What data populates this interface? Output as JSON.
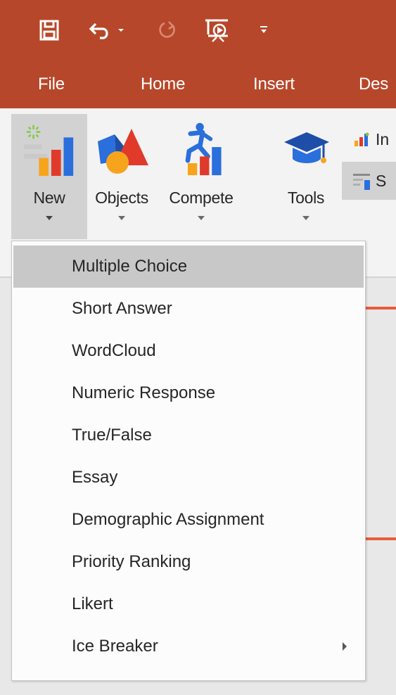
{
  "ribbon_tabs": [
    "File",
    "Home",
    "Insert",
    "Des"
  ],
  "ribbon_buttons": {
    "new_label": "New",
    "objects_label": "Objects",
    "compete_label": "Compete",
    "tools_label": "Tools"
  },
  "small_buttons": {
    "top_label": "In",
    "bottom_label": "S"
  },
  "new_menu": {
    "items": [
      "Multiple Choice",
      "Short Answer",
      "WordCloud",
      "Numeric Response",
      "True/False",
      "Essay",
      "Demographic Assignment",
      "Priority Ranking",
      "Likert",
      "Ice Breaker"
    ],
    "selected": "Multiple Choice"
  },
  "icons": {
    "save": "save-icon",
    "undo": "undo-icon",
    "redo": "redo-icon",
    "slideshow": "start-from-beginning-icon",
    "customize": "customize-qat-icon",
    "new": "new-question-icon",
    "objects": "objects-icon",
    "compete": "compete-icon",
    "tools": "tools-icon"
  },
  "colors": {
    "titlebar": "#b7472a",
    "accent": "#e85b3a",
    "menu_selected": "#c8c8c8"
  }
}
